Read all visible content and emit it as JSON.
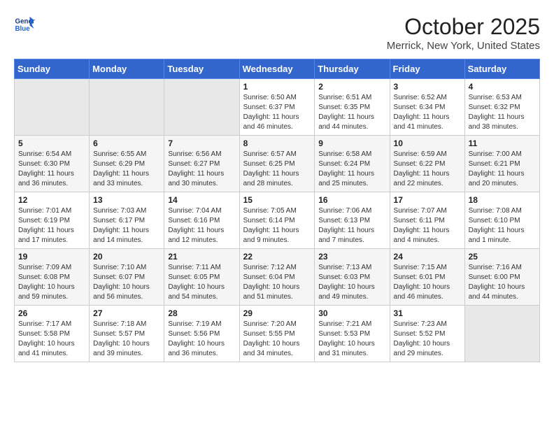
{
  "header": {
    "logo_line1": "General",
    "logo_line2": "Blue",
    "month": "October 2025",
    "location": "Merrick, New York, United States"
  },
  "weekdays": [
    "Sunday",
    "Monday",
    "Tuesday",
    "Wednesday",
    "Thursday",
    "Friday",
    "Saturday"
  ],
  "weeks": [
    [
      {
        "day": "",
        "empty": true
      },
      {
        "day": "",
        "empty": true
      },
      {
        "day": "",
        "empty": true
      },
      {
        "day": "1",
        "sunrise": "6:50 AM",
        "sunset": "6:37 PM",
        "daylight": "11 hours and 46 minutes."
      },
      {
        "day": "2",
        "sunrise": "6:51 AM",
        "sunset": "6:35 PM",
        "daylight": "11 hours and 44 minutes."
      },
      {
        "day": "3",
        "sunrise": "6:52 AM",
        "sunset": "6:34 PM",
        "daylight": "11 hours and 41 minutes."
      },
      {
        "day": "4",
        "sunrise": "6:53 AM",
        "sunset": "6:32 PM",
        "daylight": "11 hours and 38 minutes."
      }
    ],
    [
      {
        "day": "5",
        "sunrise": "6:54 AM",
        "sunset": "6:30 PM",
        "daylight": "11 hours and 36 minutes."
      },
      {
        "day": "6",
        "sunrise": "6:55 AM",
        "sunset": "6:29 PM",
        "daylight": "11 hours and 33 minutes."
      },
      {
        "day": "7",
        "sunrise": "6:56 AM",
        "sunset": "6:27 PM",
        "daylight": "11 hours and 30 minutes."
      },
      {
        "day": "8",
        "sunrise": "6:57 AM",
        "sunset": "6:25 PM",
        "daylight": "11 hours and 28 minutes."
      },
      {
        "day": "9",
        "sunrise": "6:58 AM",
        "sunset": "6:24 PM",
        "daylight": "11 hours and 25 minutes."
      },
      {
        "day": "10",
        "sunrise": "6:59 AM",
        "sunset": "6:22 PM",
        "daylight": "11 hours and 22 minutes."
      },
      {
        "day": "11",
        "sunrise": "7:00 AM",
        "sunset": "6:21 PM",
        "daylight": "11 hours and 20 minutes."
      }
    ],
    [
      {
        "day": "12",
        "sunrise": "7:01 AM",
        "sunset": "6:19 PM",
        "daylight": "11 hours and 17 minutes."
      },
      {
        "day": "13",
        "sunrise": "7:03 AM",
        "sunset": "6:17 PM",
        "daylight": "11 hours and 14 minutes."
      },
      {
        "day": "14",
        "sunrise": "7:04 AM",
        "sunset": "6:16 PM",
        "daylight": "11 hours and 12 minutes."
      },
      {
        "day": "15",
        "sunrise": "7:05 AM",
        "sunset": "6:14 PM",
        "daylight": "11 hours and 9 minutes."
      },
      {
        "day": "16",
        "sunrise": "7:06 AM",
        "sunset": "6:13 PM",
        "daylight": "11 hours and 7 minutes."
      },
      {
        "day": "17",
        "sunrise": "7:07 AM",
        "sunset": "6:11 PM",
        "daylight": "11 hours and 4 minutes."
      },
      {
        "day": "18",
        "sunrise": "7:08 AM",
        "sunset": "6:10 PM",
        "daylight": "11 hours and 1 minute."
      }
    ],
    [
      {
        "day": "19",
        "sunrise": "7:09 AM",
        "sunset": "6:08 PM",
        "daylight": "10 hours and 59 minutes."
      },
      {
        "day": "20",
        "sunrise": "7:10 AM",
        "sunset": "6:07 PM",
        "daylight": "10 hours and 56 minutes."
      },
      {
        "day": "21",
        "sunrise": "7:11 AM",
        "sunset": "6:05 PM",
        "daylight": "10 hours and 54 minutes."
      },
      {
        "day": "22",
        "sunrise": "7:12 AM",
        "sunset": "6:04 PM",
        "daylight": "10 hours and 51 minutes."
      },
      {
        "day": "23",
        "sunrise": "7:13 AM",
        "sunset": "6:03 PM",
        "daylight": "10 hours and 49 minutes."
      },
      {
        "day": "24",
        "sunrise": "7:15 AM",
        "sunset": "6:01 PM",
        "daylight": "10 hours and 46 minutes."
      },
      {
        "day": "25",
        "sunrise": "7:16 AM",
        "sunset": "6:00 PM",
        "daylight": "10 hours and 44 minutes."
      }
    ],
    [
      {
        "day": "26",
        "sunrise": "7:17 AM",
        "sunset": "5:58 PM",
        "daylight": "10 hours and 41 minutes."
      },
      {
        "day": "27",
        "sunrise": "7:18 AM",
        "sunset": "5:57 PM",
        "daylight": "10 hours and 39 minutes."
      },
      {
        "day": "28",
        "sunrise": "7:19 AM",
        "sunset": "5:56 PM",
        "daylight": "10 hours and 36 minutes."
      },
      {
        "day": "29",
        "sunrise": "7:20 AM",
        "sunset": "5:55 PM",
        "daylight": "10 hours and 34 minutes."
      },
      {
        "day": "30",
        "sunrise": "7:21 AM",
        "sunset": "5:53 PM",
        "daylight": "10 hours and 31 minutes."
      },
      {
        "day": "31",
        "sunrise": "7:23 AM",
        "sunset": "5:52 PM",
        "daylight": "10 hours and 29 minutes."
      },
      {
        "day": "",
        "empty": true
      }
    ]
  ]
}
